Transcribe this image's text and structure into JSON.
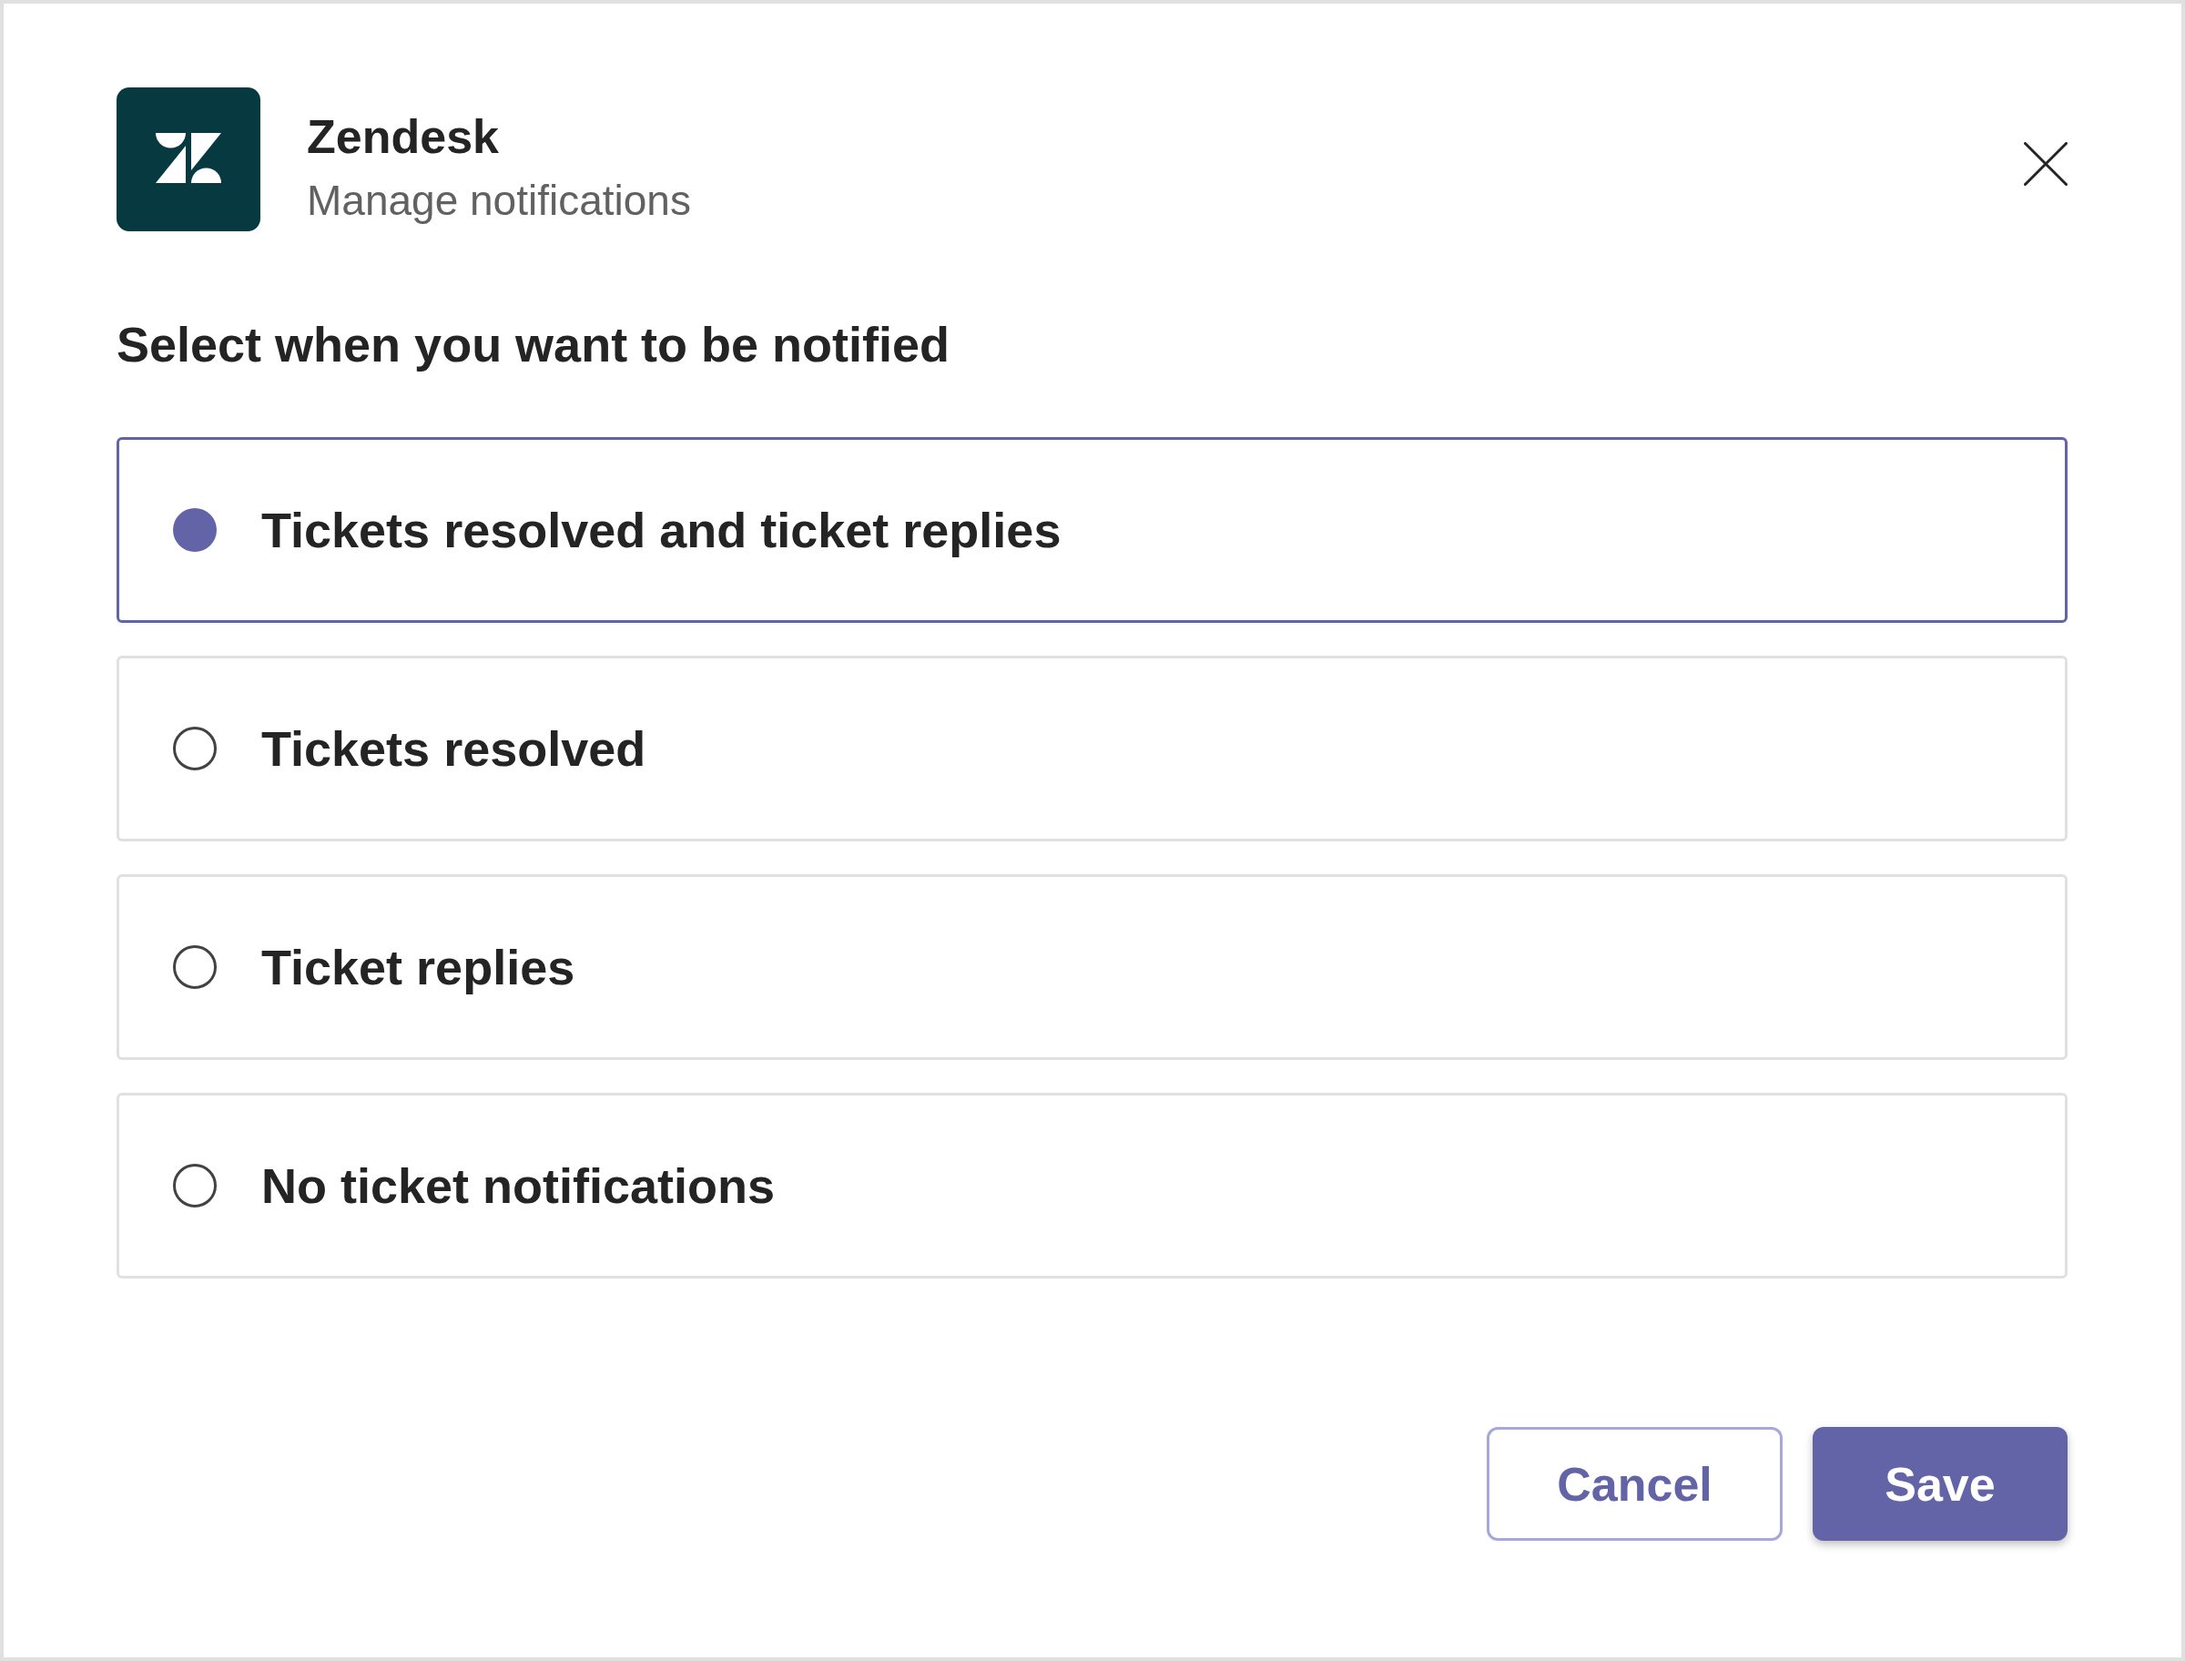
{
  "dialog": {
    "app": {
      "name": "Zendesk",
      "subtitle": "Manage notifications"
    },
    "prompt": "Select when you want to be notified",
    "options": [
      {
        "label": "Tickets resolved and ticket replies",
        "selected": true
      },
      {
        "label": "Tickets resolved",
        "selected": false
      },
      {
        "label": "Ticket replies",
        "selected": false
      },
      {
        "label": "No ticket notifications",
        "selected": false
      }
    ],
    "buttons": [
      {
        "label": "Cancel",
        "kind": "secondary"
      },
      {
        "label": "Save",
        "kind": "primary"
      }
    ]
  }
}
